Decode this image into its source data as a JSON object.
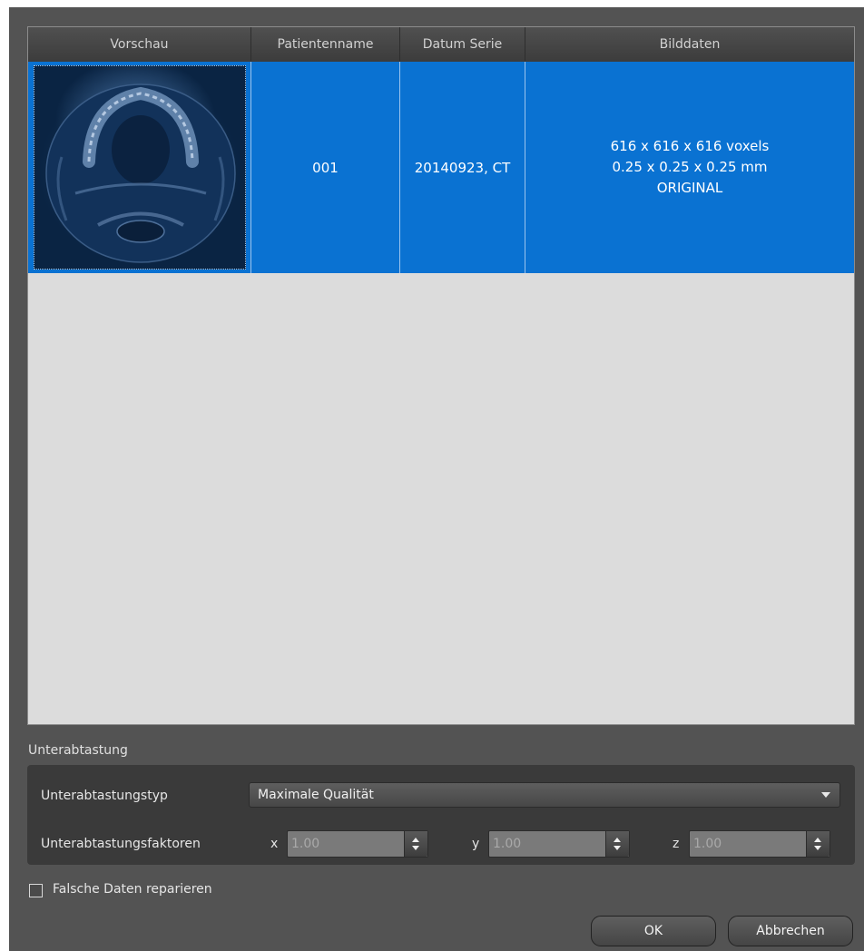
{
  "table": {
    "columns": [
      "Vorschau",
      "Patientenname",
      "Datum Serie",
      "Bilddaten"
    ],
    "rows": [
      {
        "preview_icon": "ct-scan-thumbnail",
        "patient": "001",
        "date_series": "20140923, CT",
        "image_data": [
          "616 x 616 x 616 voxels",
          "0.25 x 0.25 x 0.25 mm",
          "ORIGINAL"
        ],
        "selected": true
      }
    ]
  },
  "subsampling": {
    "title": "Unterabtastung",
    "type_label": "Unterabtastungstyp",
    "type_value": "Maximale Qualität",
    "factors_label": "Unterabtastungsfaktoren",
    "x_label": "x",
    "x_value": "1.00",
    "y_label": "y",
    "y_value": "1.00",
    "z_label": "z",
    "z_value": "1.00"
  },
  "repair": {
    "label": "Falsche Daten reparieren",
    "checked": false
  },
  "buttons": {
    "ok": "OK",
    "cancel": "Abbrechen"
  },
  "colors": {
    "selection": "#0a72d2",
    "dialog_bg": "#535353",
    "list_bg": "#dcdcdc"
  }
}
